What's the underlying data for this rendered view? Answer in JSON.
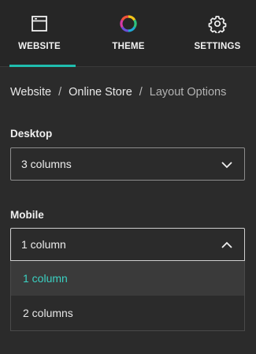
{
  "tabs": [
    {
      "label": "WEBSITE",
      "icon": "browser-window-icon",
      "active": true
    },
    {
      "label": "THEME",
      "icon": "color-wheel-icon",
      "active": false
    },
    {
      "label": "SETTINGS",
      "icon": "gear-icon",
      "active": false
    }
  ],
  "breadcrumb": {
    "items": [
      "Website",
      "Online Store",
      "Layout Options"
    ],
    "separator": "/"
  },
  "desktop": {
    "label": "Desktop",
    "value": "3 columns"
  },
  "mobile": {
    "label": "Mobile",
    "value": "1 column",
    "options": [
      "1 column",
      "2 columns"
    ]
  },
  "colors": {
    "accent": "#1fbdae",
    "selected_text": "#3ad1c2",
    "background": "#2b2b2b"
  }
}
